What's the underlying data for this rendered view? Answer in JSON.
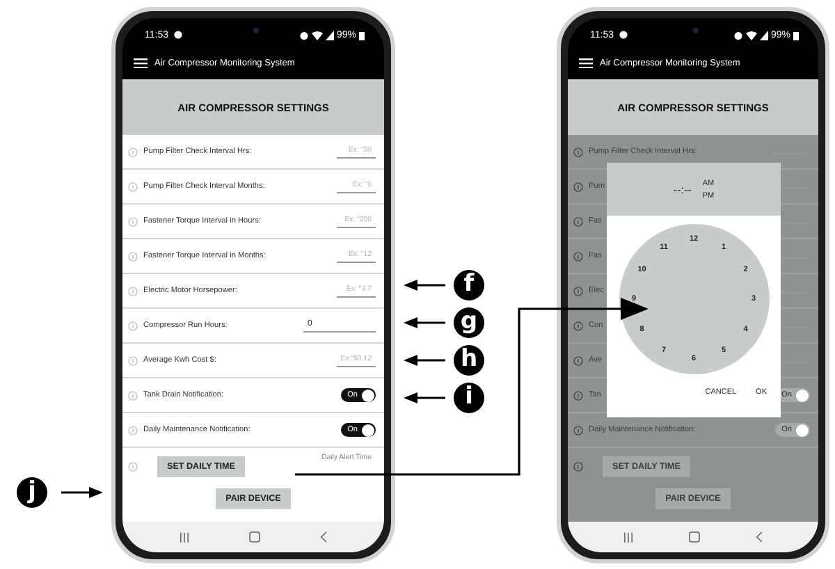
{
  "phones": [
    {
      "dimmed": false,
      "status": {
        "time": "11:53",
        "battery": "99%"
      },
      "app_title": "Air Compressor Monitoring System",
      "header": "AIR COMPRESSOR SETTINGS",
      "rows": [
        {
          "kind": "input",
          "label": "Pump Filter Check Interval Hrs:",
          "placeholder": "Ex: \"50"
        },
        {
          "kind": "input",
          "label": "Pump Filter Check Interval Months:",
          "placeholder": "Ex: \"6"
        },
        {
          "kind": "input",
          "label": "Fastener Torque Interval in Hours:",
          "placeholder": "Ex: \"200"
        },
        {
          "kind": "input",
          "label": "Fastener Torque Interval in Months:",
          "placeholder": "Ex: \"12"
        },
        {
          "kind": "input",
          "label": "Electric Motor Horsepower:",
          "placeholder": "Ex: \"3.7"
        },
        {
          "kind": "input",
          "label": "Compressor Run Hours:",
          "value": "0"
        },
        {
          "kind": "input",
          "label": "Average Kwh Cost $:",
          "placeholder": "Ex:\"$0.12"
        },
        {
          "kind": "toggle",
          "label": "Tank Drain Notification:",
          "toggle_text": "On",
          "on": true
        },
        {
          "kind": "toggle",
          "label": "Daily Maintenance Notification:",
          "toggle_text": "On",
          "on": true
        }
      ],
      "time_button": "SET DAILY TIME",
      "time_placeholder": "Daily Alert Time",
      "pair_button": "PAIR DEVICE"
    },
    {
      "dimmed": true,
      "status": {
        "time": "11:53",
        "battery": "99%"
      },
      "app_title": "Air Compressor Monitoring System",
      "header": "AIR COMPRESSOR SETTINGS",
      "rows": [
        {
          "kind": "input",
          "label": "Pump Filter Check Interval Hrs:"
        },
        {
          "kind": "input",
          "label": "Pum"
        },
        {
          "kind": "input",
          "label": "Fas"
        },
        {
          "kind": "input",
          "label": "Fas"
        },
        {
          "kind": "input",
          "label": "Elec"
        },
        {
          "kind": "input",
          "label": "Con"
        },
        {
          "kind": "input",
          "label": "Ave"
        },
        {
          "kind": "toggle",
          "label": "Tan",
          "toggle_text": "On",
          "on": true
        },
        {
          "kind": "toggle",
          "label": "Daily Maintenance Notification:",
          "toggle_text": "On",
          "on": true
        }
      ],
      "time_button": "SET DAILY TIME",
      "pair_button": "PAIR DEVICE",
      "dialog": {
        "time": "--:--",
        "am": "AM",
        "pm": "PM",
        "numbers": [
          "12",
          "1",
          "2",
          "3",
          "4",
          "5",
          "6",
          "7",
          "8",
          "9",
          "10",
          "11"
        ],
        "cancel": "CANCEL",
        "ok": "OK"
      }
    }
  ],
  "callouts": [
    {
      "letter": "f"
    },
    {
      "letter": "g"
    },
    {
      "letter": "h"
    },
    {
      "letter": "i"
    }
  ],
  "callout_j": {
    "letter": "j"
  }
}
